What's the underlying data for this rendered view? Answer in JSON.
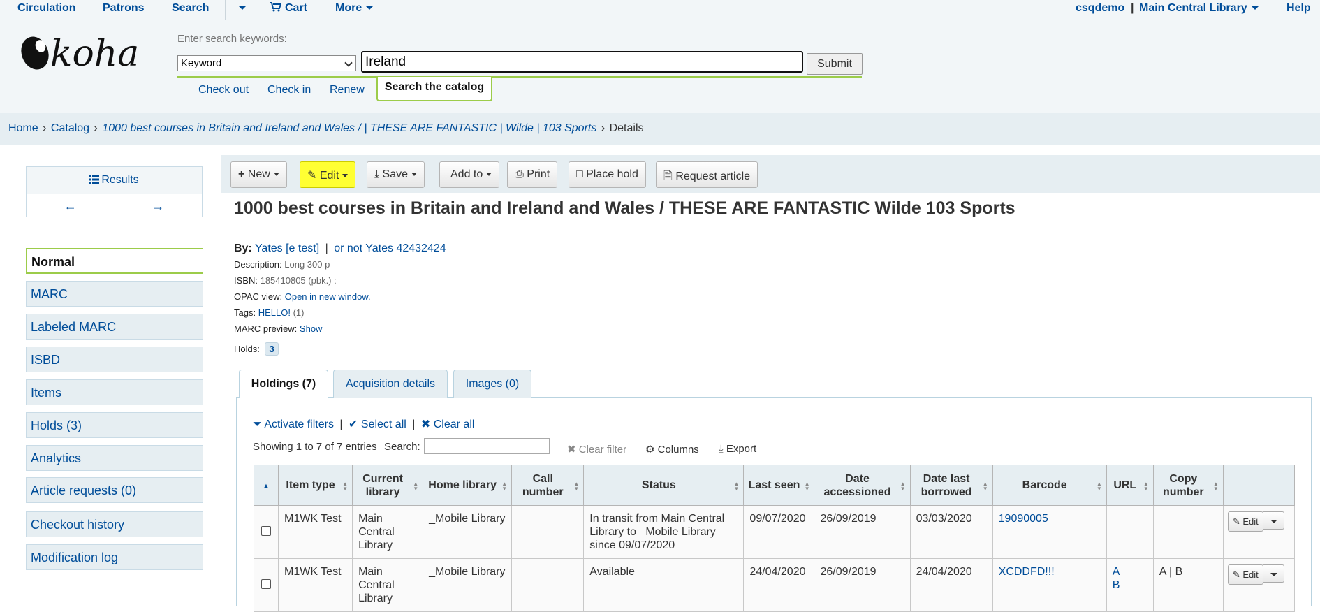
{
  "topnav": {
    "circulation": "Circulation",
    "patrons": "Patrons",
    "search": "Search",
    "cart": "Cart",
    "more": "More",
    "user": "csqdemo",
    "separator": "|",
    "library": "Main Central Library",
    "help": "Help"
  },
  "logo": {
    "text": "koha"
  },
  "search": {
    "hint": "Enter search keywords:",
    "type_selected": "Keyword",
    "query": "Ireland",
    "submit": "Submit",
    "tabs": [
      "Check out",
      "Check in",
      "Renew",
      "Search the catalog"
    ]
  },
  "breadcrumb": {
    "home": "Home",
    "catalog": "Catalog",
    "record": "1000 best courses in Britain and Ireland and Wales / | THESE ARE FANTASTIC | Wilde | 103 Sports",
    "current": "Details",
    "sep": "›"
  },
  "sidebar": {
    "results": "Results",
    "items": [
      "Normal",
      "MARC",
      "Labeled MARC",
      "ISBD",
      "Items",
      "Holds (3)",
      "Analytics",
      "Article requests (0)",
      "Checkout history",
      "Modification log"
    ]
  },
  "toolbar": {
    "new": "New",
    "edit": "Edit",
    "save": "Save",
    "add_to": "Add to",
    "print": "Print",
    "place_hold": "Place hold",
    "request_article": "Request article"
  },
  "record": {
    "title": "1000 best courses in Britain and Ireland and Wales / THESE ARE FANTASTIC Wilde 103 Sports",
    "by_label": "By:",
    "author1": "Yates [e test]",
    "author_sep": "|",
    "author2": "or not Yates 42432424",
    "description_label": "Description:",
    "description": "Long 300 p",
    "isbn_label": "ISBN:",
    "isbn": "185410805 (pbk.) :",
    "opac_label": "OPAC view:",
    "opac_link": "Open in new window.",
    "tags_label": "Tags:",
    "tag": "HELLO!",
    "tag_count": "(1)",
    "marc_label": "MARC preview:",
    "marc_link": "Show",
    "holds_label": "Holds:",
    "holds_count": "3"
  },
  "tabs": [
    "Holdings (7)",
    "Acquisition details",
    "Images (0)"
  ],
  "holdings": {
    "activate_filters": "Activate filters",
    "select_all": "Select all",
    "clear_all": "Clear all",
    "bar": "|",
    "entries": "Showing 1 to 7 of 7 entries",
    "search_label": "Search:",
    "clear_filter": "Clear filter",
    "columns": "Columns",
    "export": "Export",
    "headers": [
      "Item type",
      "Current library",
      "Home library",
      "Call number",
      "Status",
      "Last seen",
      "Date accessioned",
      "Date last borrowed",
      "Barcode",
      "URL",
      "Copy number"
    ],
    "rows": [
      {
        "item_type": "M1WK Test",
        "current_library": "Main Central Library",
        "home_library": "_Mobile Library",
        "call_number": "",
        "status": "In transit from Main Central Library to _Mobile Library since 09/07/2020",
        "last_seen": "09/07/2020",
        "date_accessioned": "26/09/2019",
        "date_last_borrowed": "03/03/2020",
        "barcode": "19090005",
        "url_a": "",
        "url_b": "",
        "copy_number": "",
        "edit": "Edit"
      },
      {
        "item_type": "M1WK Test",
        "current_library": "Main Central Library",
        "home_library": "_Mobile Library",
        "call_number": "",
        "status": "Available",
        "last_seen": "24/04/2020",
        "date_accessioned": "26/09/2019",
        "date_last_borrowed": "24/04/2020",
        "barcode": "XCDDFD!!!",
        "url_a": "A",
        "url_b": "B",
        "copy_number": "A | B",
        "edit": "Edit"
      }
    ]
  },
  "colors": {
    "link": "#004d99",
    "accent_green": "#9ccc4a",
    "highlight": "#ffff33",
    "panel": "#e6eef2"
  }
}
